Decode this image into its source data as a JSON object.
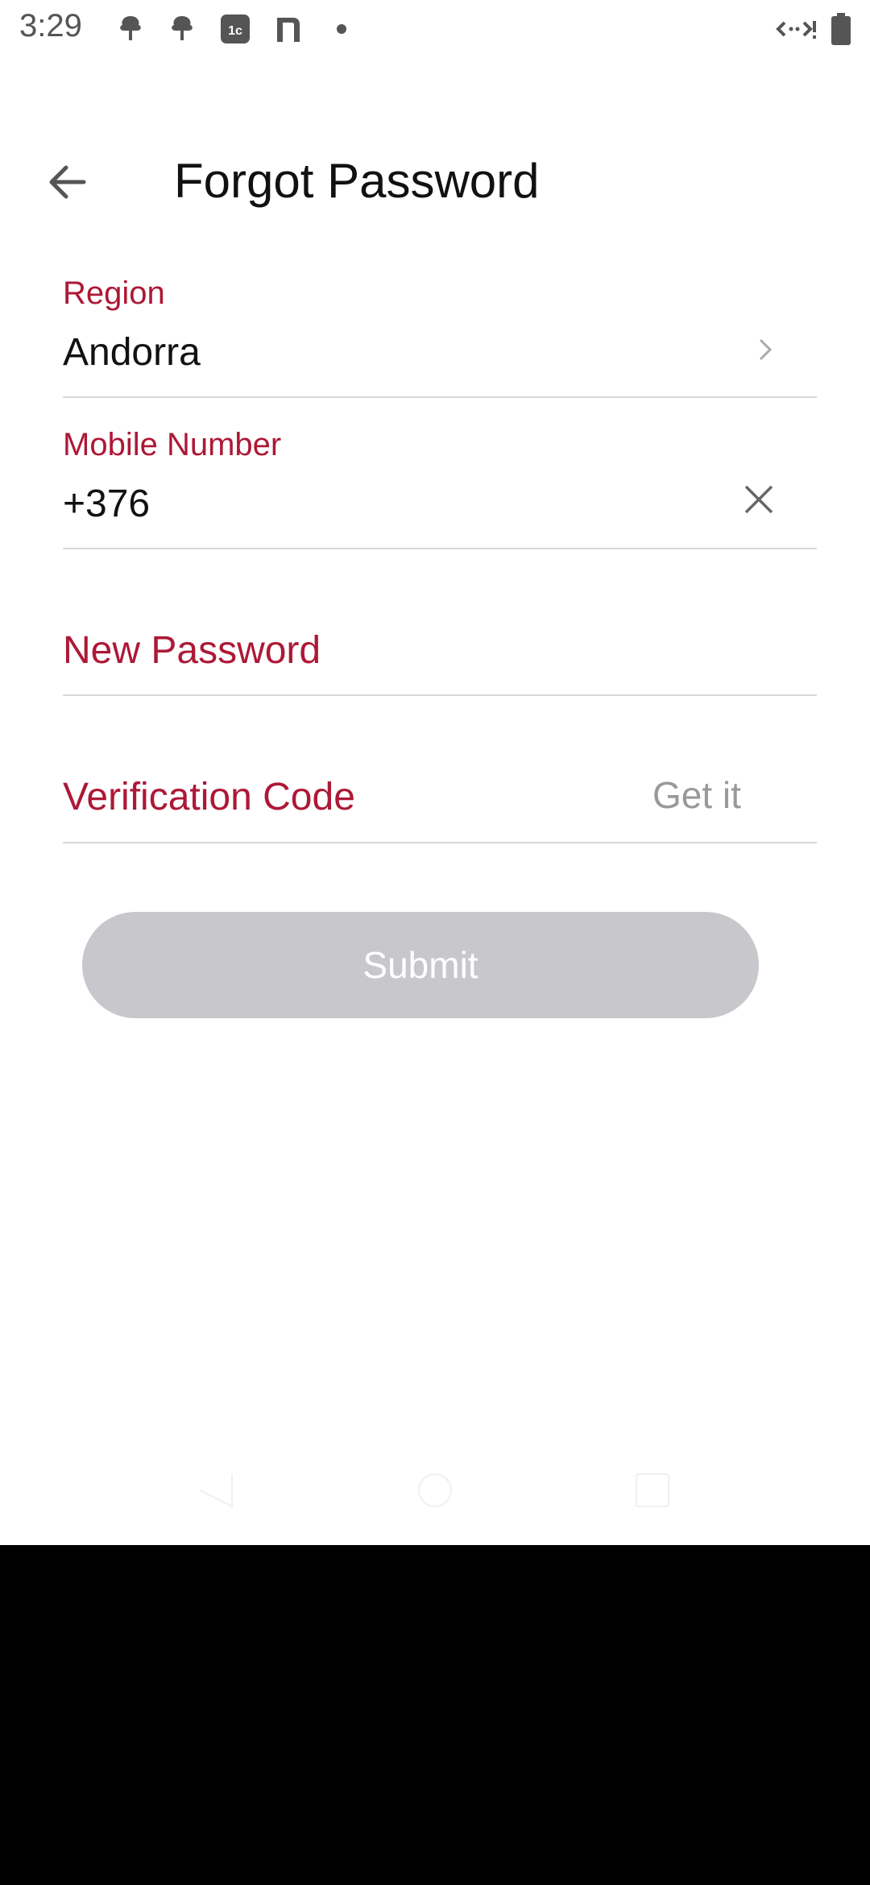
{
  "status_bar": {
    "time": "3:29",
    "icons_left": [
      "tree-icon",
      "tree-icon",
      "app-1c-icon",
      "n-app-icon",
      "dot-icon"
    ],
    "icons_right": [
      "network-icon",
      "battery-icon"
    ]
  },
  "header": {
    "title": "Forgot Password",
    "back_icon": "arrow-left-icon"
  },
  "form": {
    "region": {
      "label": "Region",
      "value": "Andorra"
    },
    "mobile": {
      "label": "Mobile Number",
      "value": "+376"
    },
    "new_password": {
      "label": "New Password"
    },
    "verification_code": {
      "label": "Verification Code",
      "get_code_label": "Get it"
    },
    "submit_label": "Submit"
  },
  "colors": {
    "accent": "#ad1836",
    "button_disabled": "#c8c8cc",
    "divider": "#d9d9d9"
  }
}
